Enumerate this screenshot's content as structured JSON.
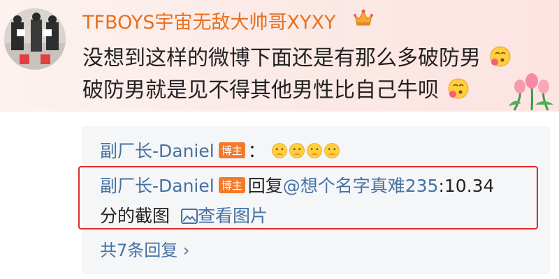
{
  "post": {
    "username": "TFBOYS宇宙无敌大帅哥XYXY",
    "line1": "没想到这样的微博下面还是有那么多破防男",
    "line2": "破防男就是见不得其他男性比自己牛呗"
  },
  "replies": {
    "r1": {
      "name": "副厂长-Daniel",
      "badge": "博主",
      "sep": "："
    },
    "r2": {
      "name": "副厂长-Daniel",
      "badge": "博主",
      "prefix": "回复",
      "mention": "@想个名字真难235",
      "text_a": ":10.34",
      "text_b": "分的截图",
      "link": "查看图片"
    },
    "more": "共7条回复 ›"
  },
  "colors": {
    "username": "#e7701e",
    "link": "#4671a3",
    "highlight": "#e22a2a"
  }
}
